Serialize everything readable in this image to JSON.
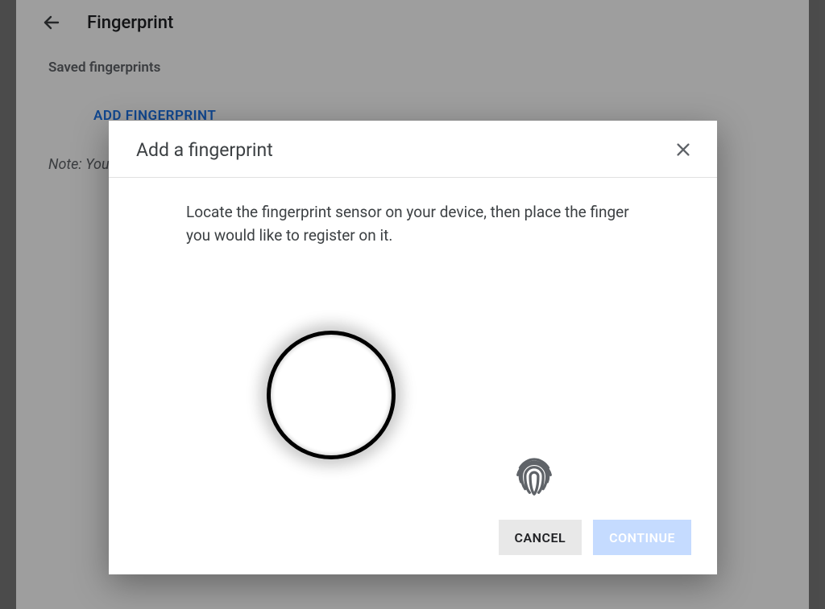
{
  "page": {
    "title": "Fingerprint",
    "section_label": "Saved fingerprints",
    "add_link": "ADD FINGERPRINT",
    "note_prefix": "Note: You"
  },
  "dialog": {
    "title": "Add a fingerprint",
    "instruction": "Locate the fingerprint sensor on your device, then place the finger you would like to register on it.",
    "cancel": "CANCEL",
    "continue": "CONTINUE"
  }
}
